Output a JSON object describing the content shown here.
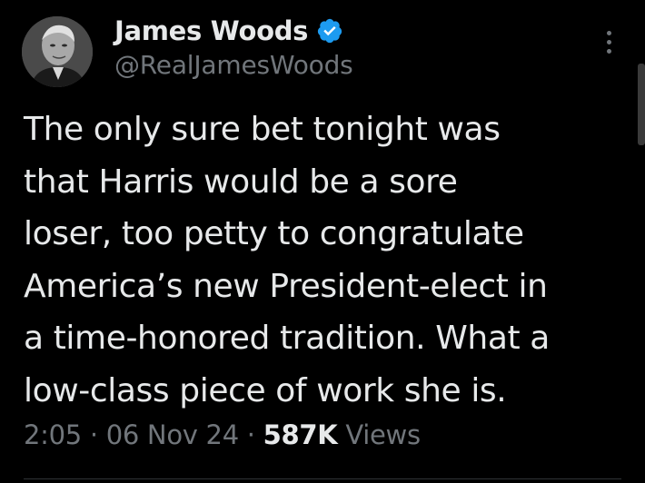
{
  "author": {
    "name": "James Woods",
    "handle": "@RealJamesWoods",
    "verified": true,
    "verified_color": "#1d9bf0"
  },
  "tweet": {
    "lines": [
      "The only sure bet tonight was",
      "that Harris would be a sore",
      "loser, too petty to congratulate",
      "America’s new President-elect in",
      "a time-honored tradition. What a",
      "low-class piece of work she is."
    ]
  },
  "meta": {
    "time": "2:05",
    "separator": "·",
    "date": "06 Nov 24",
    "views_count": "587K",
    "views_label": "Views"
  },
  "icons": {
    "more": "more-vertical-icon",
    "verified": "verified-badge-icon"
  },
  "colors": {
    "background": "#000000",
    "text": "#e7e9ea",
    "secondary": "#71767b"
  }
}
